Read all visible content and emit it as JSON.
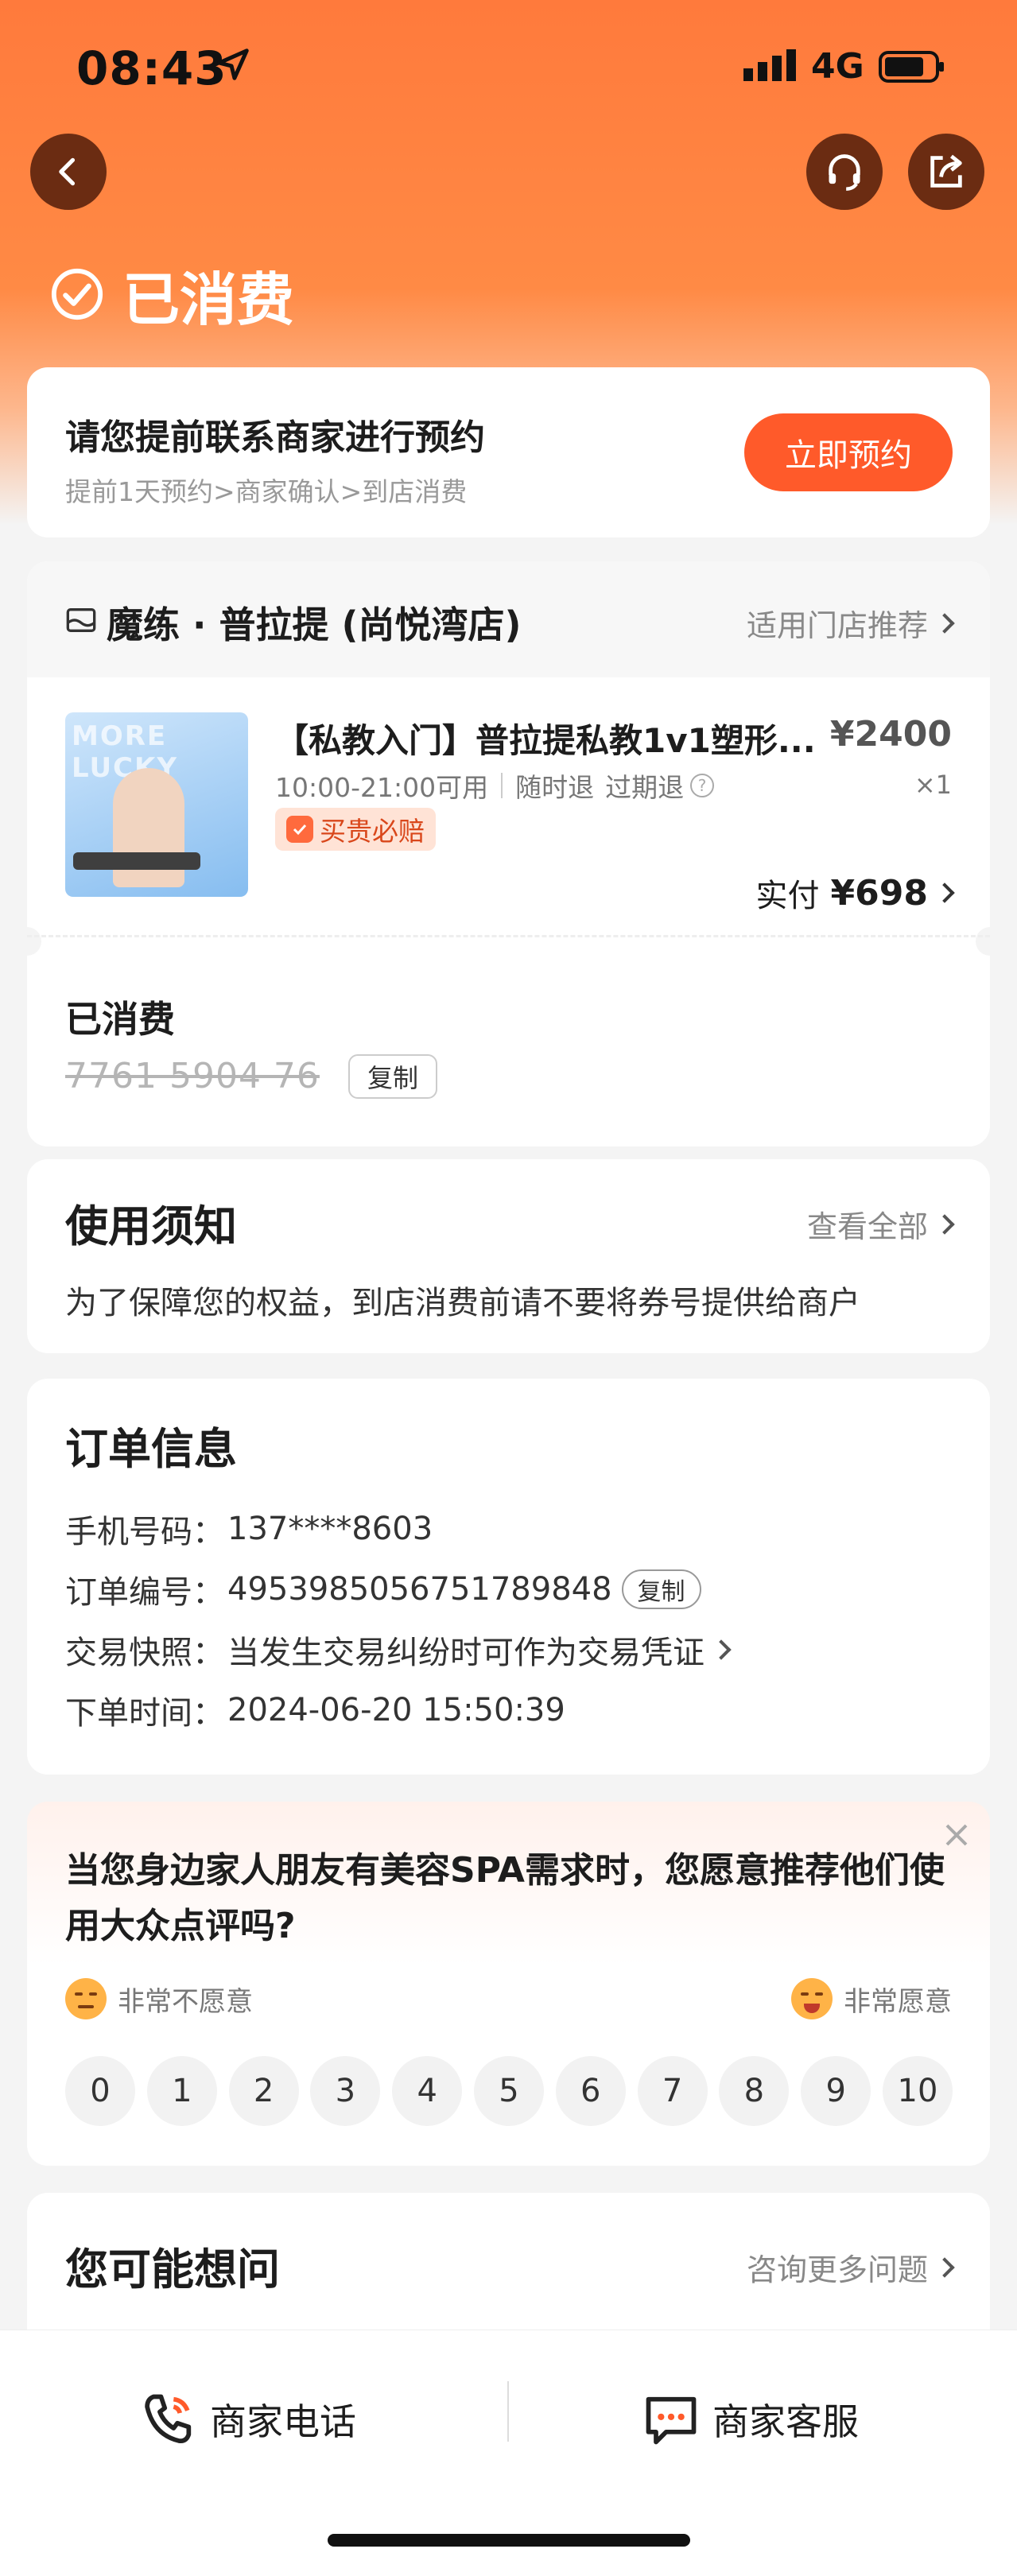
{
  "status_bar": {
    "time": "08:43",
    "network": "4G"
  },
  "header": {
    "state_title": "已消费"
  },
  "booking": {
    "title": "请您提前联系商家进行预约",
    "subtitle": "提前1天预约>商家确认>到店消费",
    "button": "立即预约"
  },
  "shop": {
    "name": "魔练 · 普拉提 (尚悦湾店)",
    "link": "适用门店推荐"
  },
  "product": {
    "thumb_text": "MORE LUCKY",
    "title": "【私教入门】普拉提私教1v1塑形...",
    "price": "¥2400",
    "hours": "10:00-21:00可用",
    "refund_any": "随时退",
    "refund_expired": "过期退",
    "qty": "×1",
    "guarantee": "买贵必赔",
    "paid_label": "实付",
    "paid_value": "¥698"
  },
  "coupon": {
    "status": "已消费",
    "code": "7761 5904 76",
    "copy": "复制"
  },
  "notice": {
    "title": "使用须知",
    "link": "查看全部",
    "text": "为了保障您的权益，到店消费前请不要将券号提供给商户"
  },
  "order": {
    "title": "订单信息",
    "phone_label": "手机号码：",
    "phone_value": "137****8603",
    "order_no_label": "订单编号：",
    "order_no_value": "4953985056751789848",
    "order_no_copy": "复制",
    "snapshot_label": "交易快照：",
    "snapshot_value": "当发生交易纠纷时可作为交易凭证",
    "time_label": "下单时间：",
    "time_value": "2024-06-20 15:50:39"
  },
  "survey": {
    "question": "当您身边家人朋友有美容SPA需求时，您愿意推荐他们使用大众点评吗?",
    "low_label": "非常不愿意",
    "high_label": "非常愿意",
    "scores": [
      "0",
      "1",
      "2",
      "3",
      "4",
      "5",
      "6",
      "7",
      "8",
      "9",
      "10"
    ]
  },
  "faq": {
    "title": "您可能想问",
    "link": "咨询更多问题"
  },
  "bottom_bar": {
    "phone": "商家电话",
    "chat": "商家客服"
  },
  "colors": {
    "accent": "#ff5a2a",
    "hero": "#ff7a3c",
    "brown": "#6b2c12"
  }
}
